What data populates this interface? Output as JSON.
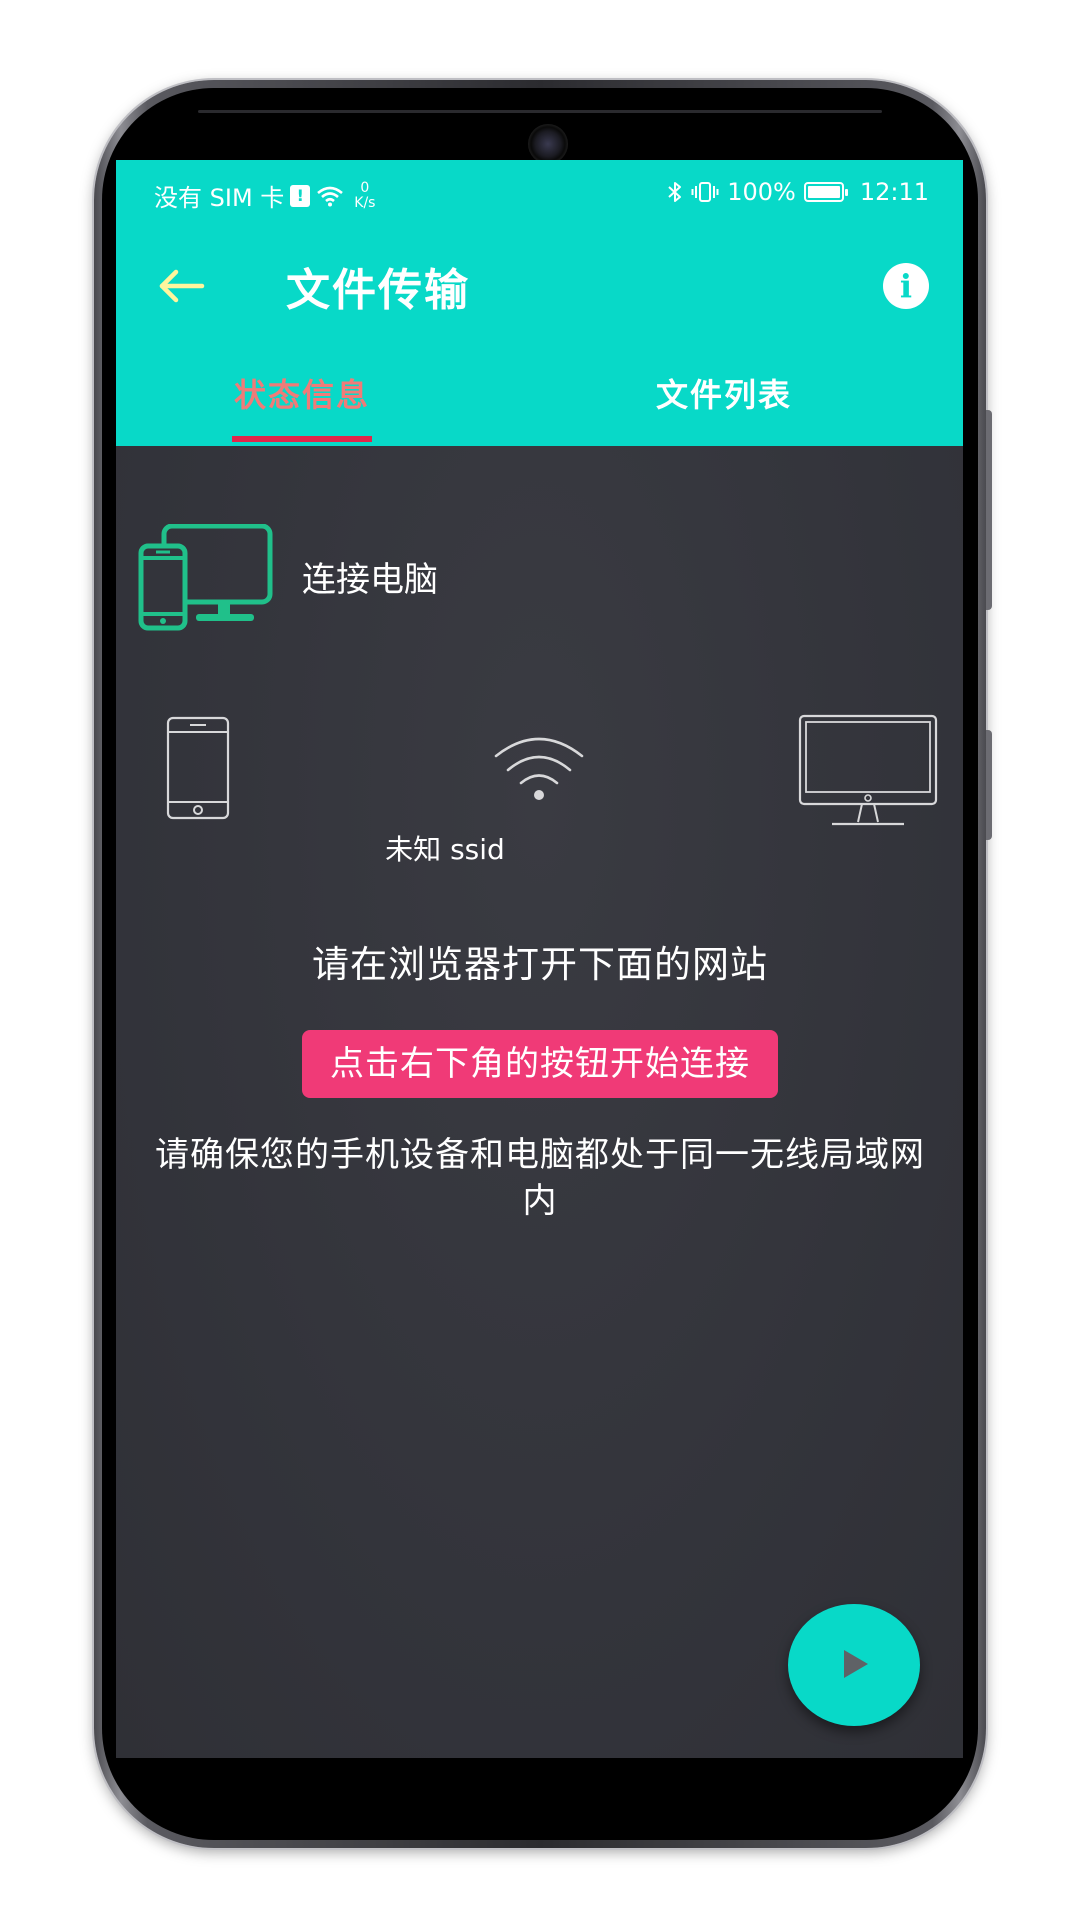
{
  "status_bar": {
    "carrier": "没有 SIM 卡",
    "sim_badge": "!",
    "net_speed_value": "0",
    "net_speed_unit": "K/s",
    "battery": "100%",
    "time": "12:11"
  },
  "app_bar": {
    "title": "文件传输",
    "info_glyph": "i"
  },
  "tabs": [
    {
      "label": "状态信息",
      "selected": true
    },
    {
      "label": "文件列表",
      "selected": false
    }
  ],
  "content": {
    "connect_label": "连接电脑",
    "ssid": "未知 ssid",
    "instruction": "请在浏览器打开下面的网站",
    "start_tip": "点击右下角的按钮开始连接",
    "network_note": "请确保您的手机设备和电脑都处于同一无线局域网内"
  },
  "colors": {
    "accent": "#08d9c8",
    "tab_selected": "#f07b78",
    "tab_indicator": "#e2264a",
    "tip_background": "#f03a77",
    "back_arrow": "#fff59d",
    "background": "#33343b"
  },
  "battery_level": 1.0,
  "icons": [
    "back-arrow-icon",
    "info-icon",
    "computer-phone-icon",
    "phone-outline-icon",
    "wifi-icon",
    "monitor-outline-icon",
    "play-icon",
    "bluetooth-icon",
    "vibrate-icon",
    "battery-icon"
  ]
}
